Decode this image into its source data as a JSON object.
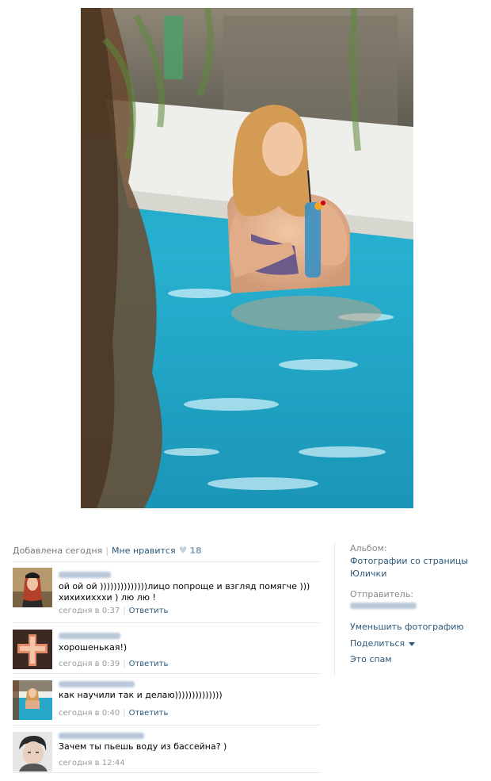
{
  "photo": {
    "subject": "woman-in-pool-photo"
  },
  "info": {
    "added": "Добавлена сегодня",
    "like_label": "Мне нравится",
    "like_count": "18",
    "heart_icon": "heart-icon"
  },
  "comments": [
    {
      "avatar": "avatar-woman-red-hair",
      "text": "ой ой ой ))))))))))))))лицо попроще и взгляд помягче ))) хихихихххи ) лю лю !",
      "time": "сегодня в 0:37",
      "reply": "Ответить"
    },
    {
      "avatar": "avatar-cross-emblem",
      "text": "хорошенькая!)",
      "time": "сегодня в 0:39",
      "reply": "Ответить"
    },
    {
      "avatar": "avatar-pool-photo",
      "text": "как научили так и делаю))))))))))))))",
      "time": "сегодня в 0:40",
      "reply": "Ответить"
    },
    {
      "avatar": "avatar-man-portrait",
      "text": "Зачем ты пьешь воду из бассейна? )",
      "time": "сегодня в 12:44"
    }
  ],
  "sidebar": {
    "album_label": "Альбом:",
    "album_name": "Фотографии со страницы Юлички",
    "sender_label": "Отправитель:",
    "actions": {
      "reduce": "Уменьшить фотографию",
      "share": "Поделиться",
      "spam": "Это спам"
    }
  },
  "colors": {
    "link": "#2b587a",
    "meta": "#999999",
    "pool": "#1fa3c7"
  }
}
